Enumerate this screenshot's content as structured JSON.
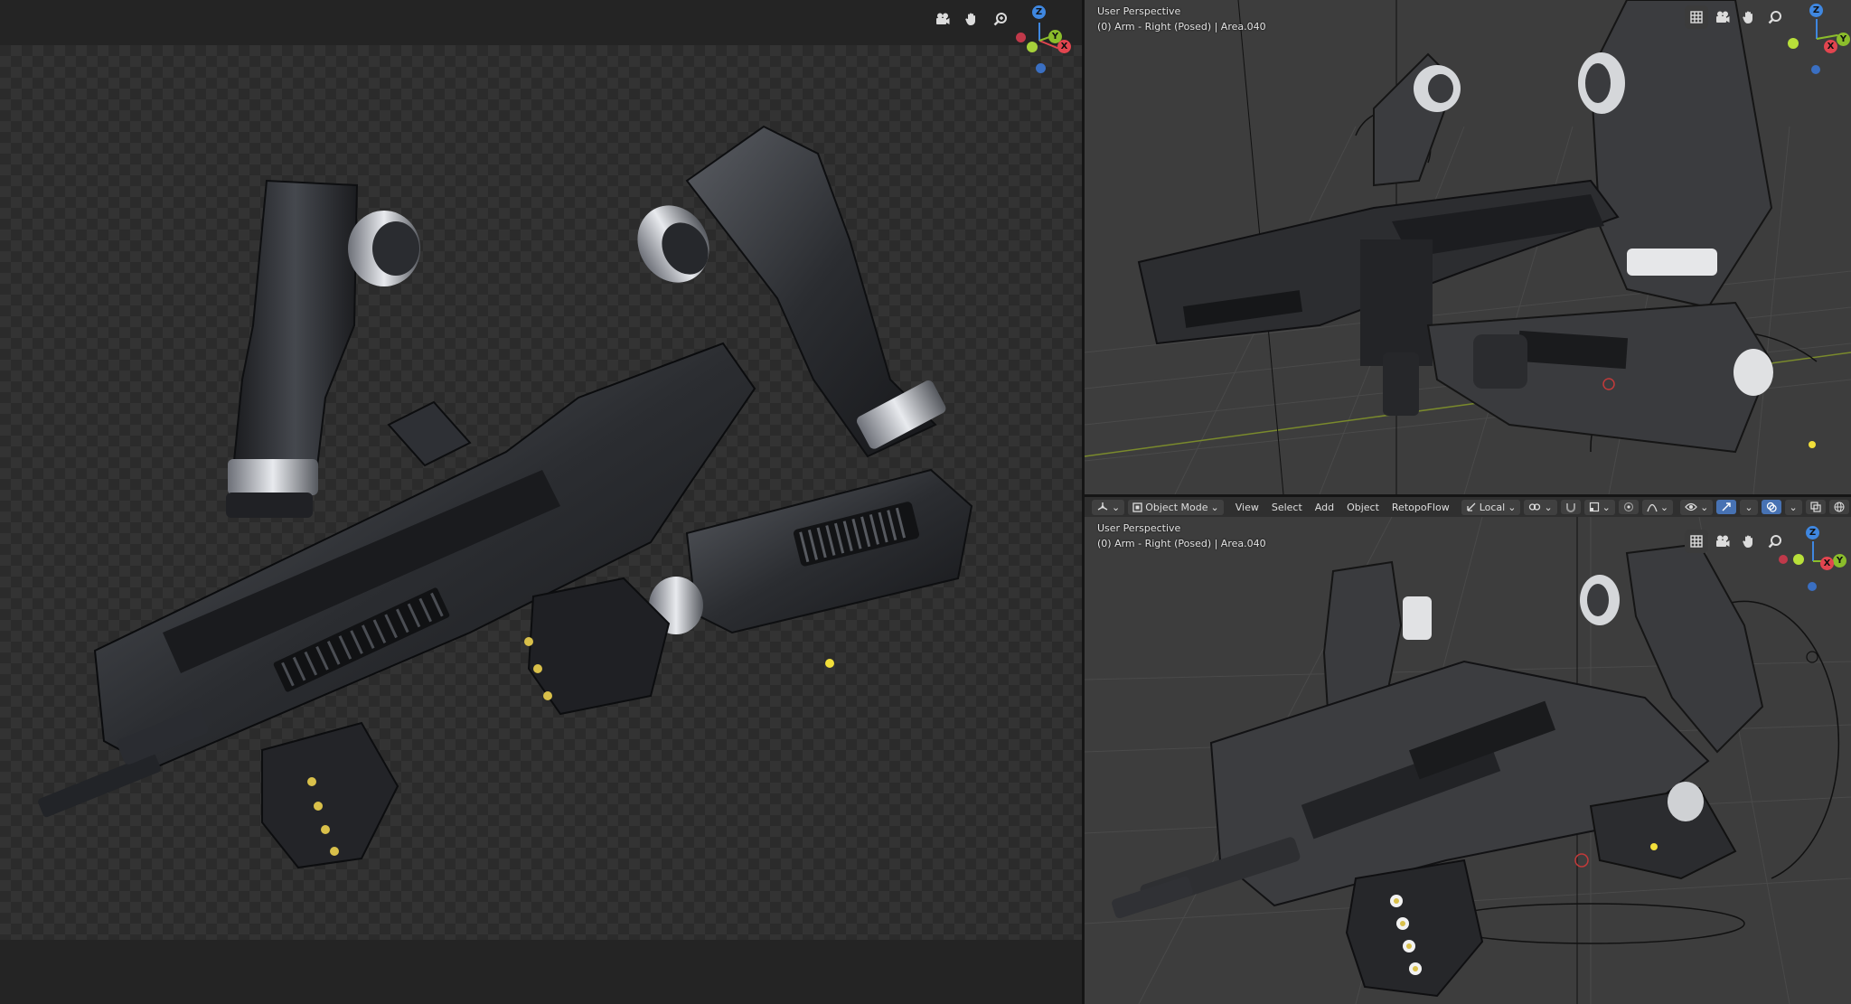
{
  "left_viewport": {
    "tools": [
      "camera-icon",
      "hand-pan-icon",
      "zoom-icon"
    ],
    "gizmo": {
      "z": "Z",
      "y": "Y",
      "x": "X"
    }
  },
  "top_right_viewport": {
    "line1": "User Perspective",
    "line2": "(0) Arm - Right (Posed) | Area.040",
    "tools": [
      "grid-icon",
      "camera-icon",
      "hand-pan-icon",
      "zoom-icon"
    ],
    "gizmo": {
      "z": "Z",
      "y": "Y",
      "x": "X"
    }
  },
  "header": {
    "mode": "Object Mode",
    "menus": [
      "View",
      "Select",
      "Add",
      "Object",
      "RetopoFlow"
    ],
    "transform_orientation": "Local"
  },
  "bottom_right_viewport": {
    "line1": "User Perspective",
    "line2": "(0) Arm - Right (Posed) | Area.040",
    "tools": [
      "grid-icon",
      "camera-icon",
      "hand-pan-icon",
      "zoom-icon"
    ],
    "gizmo": {
      "z": "Z",
      "y": "Y",
      "x": "X"
    }
  },
  "colors": {
    "axis_x": "#e2454f",
    "axis_y": "#8bbd2b",
    "axis_z": "#3f87e0",
    "active_blue": "#4772b3",
    "light_yellow": "#f2df3a"
  }
}
